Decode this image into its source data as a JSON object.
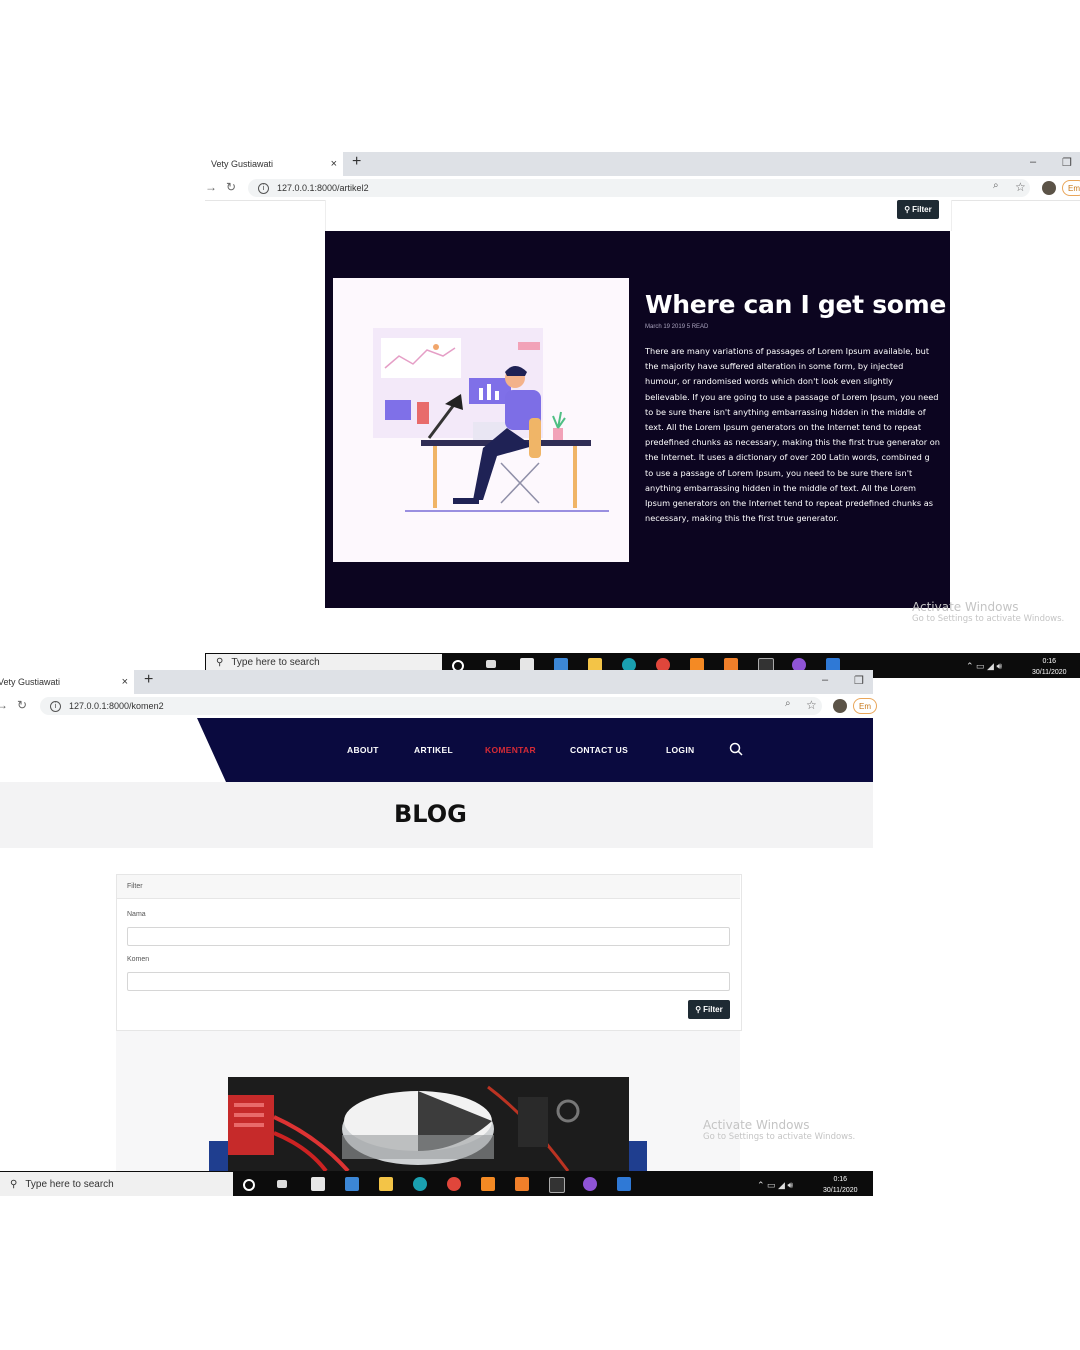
{
  "window_top": {
    "tab_title": "Vety Gustiawati",
    "tab_close": "×",
    "new_tab": "+",
    "win_min": "‒",
    "win_restore": "❐",
    "url": "127.0.0.1:8000/artikel2",
    "profile_label": "Em",
    "filter_button": "Filter",
    "article": {
      "title": "Where can I get some",
      "meta": "March 19 2019 5 READ",
      "body": "There are many variations of passages of Lorem Ipsum available, but the majority have suffered alteration in some form, by injected humour, or randomised words which don't look even slightly believable. If you are going to use a passage of Lorem Ipsum, you need to be sure there isn't anything embarrassing hidden in the middle of text. All the Lorem Ipsum generators on the Internet tend to repeat predefined chunks as necessary, making this the first true generator on the Internet. It uses a dictionary of over 200 Latin words, combined g to use a passage of Lorem Ipsum, you need to be sure there isn't anything embarrassing hidden in the middle of text. All the Lorem Ipsum generators on the Internet tend to repeat predefined chunks as necessary, making this the first true generator."
    },
    "activate": {
      "title": "Activate Windows",
      "subtitle": "Go to Settings to activate Windows."
    },
    "taskbar": {
      "search_placeholder": "Type here to search",
      "time": "0:16",
      "date": "30/11/2020"
    }
  },
  "window_bottom": {
    "tab_title": "Vety Gustiawati",
    "tab_close": "×",
    "new_tab": "+",
    "win_min": "‒",
    "win_restore": "❐",
    "url": "127.0.0.1:8000/komen2",
    "profile_label": "Em",
    "nav": {
      "items": [
        "ABOUT",
        "ARTIKEL",
        "KOMENTAR",
        "CONTACT US",
        "LOGIN"
      ],
      "active": "KOMENTAR"
    },
    "page_title": "BLOG",
    "filter_card": {
      "header": "Filter",
      "nama_label": "Nama",
      "nama_value": "",
      "komen_label": "Komen",
      "komen_value": "",
      "button": "Filter"
    },
    "activate": {
      "title": "Activate Windows",
      "subtitle": "Go to Settings to activate Windows."
    },
    "taskbar": {
      "search_placeholder": "Type here to search",
      "time": "0:16",
      "date": "30/11/2020"
    }
  },
  "colors": {
    "article_bg": "#0c0520",
    "navbar_bg": "#0a0a3f",
    "nav_active": "#d62b36",
    "filter_btn": "#1e2a33"
  },
  "icons": [
    "back-arrow-icon",
    "reload-icon",
    "info-icon",
    "zoom-icon",
    "star-icon",
    "search-icon",
    "cortana-icon",
    "task-view-icon",
    "store-icon",
    "mail-icon",
    "explorer-icon",
    "edge-icon",
    "chrome-icon",
    "sublime-icon",
    "xampp-icon",
    "terminal-icon",
    "app-icon",
    "photos-icon"
  ]
}
